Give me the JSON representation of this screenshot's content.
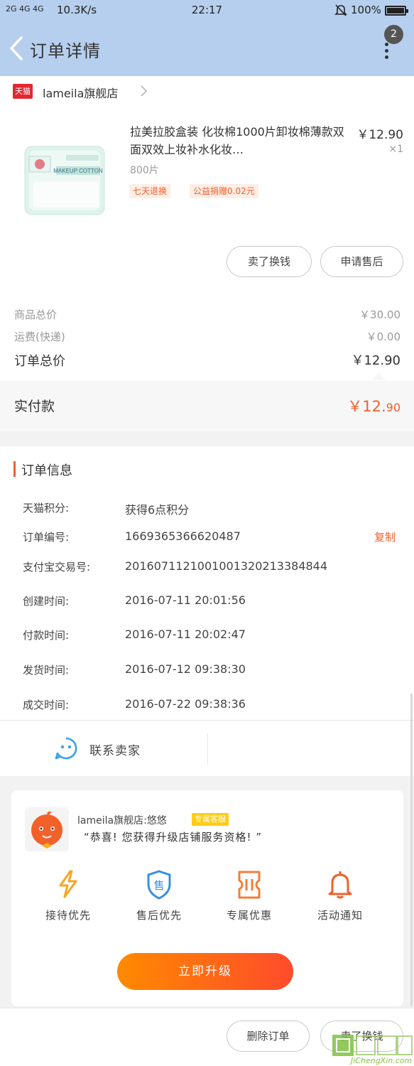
{
  "status_bar": {
    "signal": "2G 4G 4G",
    "speed": "10.3K/s",
    "time": "22:17",
    "battery": "100%"
  },
  "header": {
    "title": "订单详情",
    "message_count": "2"
  },
  "store": {
    "badge": "天猫",
    "name": "lameila旗舰店"
  },
  "product": {
    "title": "拉美拉胶盒装 化妆棉1000片卸妆棉薄款双面双效上妆补水化妆…",
    "price": "￥12.90",
    "quantity": "×1",
    "sku": "800片",
    "tags": [
      "七天退换",
      "公益捐赠0.02元"
    ],
    "image_text": "MAKEUP COTTON"
  },
  "actions": {
    "sell": "卖了换钱",
    "after_sale": "申请售后",
    "delete": "删除订单"
  },
  "summary": {
    "goods_label": "商品总价",
    "goods_value": "￥30.00",
    "shipping_label": "运费(快递)",
    "shipping_value": "￥0.00",
    "total_label": "订单总价",
    "total_value": "￥12.90",
    "paid_label": "实付款",
    "paid_value_main": "￥12.",
    "paid_value_cents": "90"
  },
  "order_info": {
    "title": "订单信息",
    "rows": [
      {
        "label": "天猫积分:",
        "value": "获得6点积分"
      },
      {
        "label": "订单编号:",
        "value": "1669365366620487"
      },
      {
        "label": "支付宝交易号:",
        "value": "2016071121001001320213384844"
      },
      {
        "label": "创建时间:",
        "value": "2016-07-11 20:01:56"
      },
      {
        "label": "付款时间:",
        "value": "2016-07-11 20:02:47"
      },
      {
        "label": "发货时间:",
        "value": "2016-07-12 09:38:30"
      },
      {
        "label": "成交时间:",
        "value": "2016-07-22 09:38:36"
      }
    ],
    "copy_label": "复制",
    "contact_label": "联系卖家"
  },
  "upgrade": {
    "csr_name": "lameila旗舰店:悠悠",
    "csr_badge": "专属客服",
    "quote": "“恭喜! 您获得升级店铺服务资格! ”",
    "perks": [
      {
        "label": "接待优先",
        "icon": "lightning-icon",
        "color": "#f5a623"
      },
      {
        "label": "售后优先",
        "icon": "shield-sale-icon",
        "color": "#3a8fe0"
      },
      {
        "label": "专属优惠",
        "icon": "coupon-icon",
        "color": "#f57c3a"
      },
      {
        "label": "活动通知",
        "icon": "bell-icon",
        "color": "#f0602b"
      }
    ],
    "perk_shield_char": "售",
    "button": "立即升级"
  },
  "watermark": {
    "text": "JiChengXin.com"
  },
  "colors": {
    "header_bg": "#b6cfee",
    "accent": "#f0602b",
    "tmall_red": "#e4262f"
  }
}
